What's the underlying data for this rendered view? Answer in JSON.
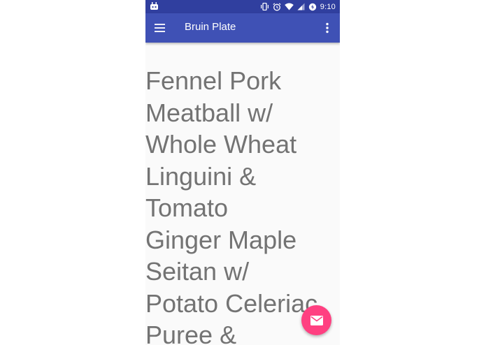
{
  "status_bar": {
    "time": "9:10",
    "icons": [
      "android-debug-icon",
      "vibrate-icon",
      "alarm-icon",
      "wifi-icon",
      "signal-icon",
      "battery-charging-icon"
    ]
  },
  "app_bar": {
    "title": "Bruin Plate",
    "menu_icon": "hamburger-menu-icon",
    "overflow_icon": "more-vert-icon"
  },
  "content": {
    "lines": [
      "Fennel Pork",
      "Meatball w/",
      "Whole Wheat",
      "Linguini &",
      "Tomato",
      "Ginger Maple",
      "Seitan w/",
      "Potato Celeriac",
      "Puree &"
    ]
  },
  "fab": {
    "icon": "email-icon"
  },
  "colors": {
    "status_bar": "#303f9f",
    "app_bar": "#3f51b5",
    "accent": "#ff4081",
    "text": "#737373",
    "background": "#fafafa"
  }
}
